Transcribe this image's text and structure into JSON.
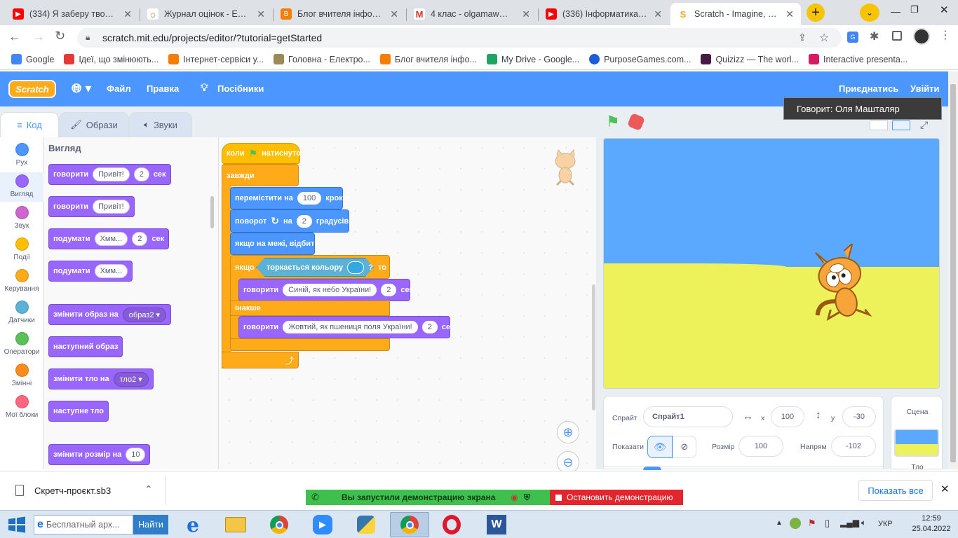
{
  "browser": {
    "tabs": [
      {
        "title": "(334) Я заберу твою се",
        "icon": "youtube-icon",
        "color": "#ff0000"
      },
      {
        "title": "Журнал оцінок - Елект",
        "icon": "sun-icon",
        "color": "#9b8a55"
      },
      {
        "title": "Блог вчителя інформа",
        "icon": "blogger-icon",
        "color": "#f57d00"
      },
      {
        "title": "4 клас - olgamaw@gm",
        "icon": "gmail-icon",
        "color": "#d93025"
      },
      {
        "title": "(336) Інформатика 4 кл",
        "icon": "youtube-icon",
        "color": "#ff0000"
      },
      {
        "title": "Scratch - Imagine, Prog",
        "icon": "scratch-icon",
        "color": "#f6a623",
        "active": true
      }
    ],
    "url": "scratch.mit.edu/projects/editor/?tutorial=getStarted",
    "bookmarks": [
      {
        "label": "Google",
        "color": "#4285f4"
      },
      {
        "label": "Ідеї, що змінюють...",
        "color": "#e53935"
      },
      {
        "label": "Інтернет-сервіси у...",
        "color": "#f57d00"
      },
      {
        "label": "Головна - Електро...",
        "color": "#9b8a55"
      },
      {
        "label": "Блог вчителя інфо...",
        "color": "#f57d00"
      },
      {
        "label": "My Drive - Google...",
        "color": "#1fa463"
      },
      {
        "label": "PurposeGames.com...",
        "color": "#1e5bd6"
      },
      {
        "label": "Quizizz — The worl...",
        "color": "#461a42"
      },
      {
        "label": "Interactive presenta...",
        "color": "#d81b60"
      }
    ]
  },
  "scratch": {
    "menu": {
      "file": "Файл",
      "edit": "Правка",
      "tutorials": "Посібники",
      "join": "Приєднатись",
      "signin": "Увійти"
    },
    "tooltip": "Говорит: Оля Машталяр",
    "tabs": {
      "code": "Код",
      "costumes": "Образи",
      "sounds": "Звуки"
    },
    "categories": [
      {
        "label": "Рух",
        "color": "#4c97ff"
      },
      {
        "label": "Вигляд",
        "color": "#9966ff"
      },
      {
        "label": "Звук",
        "color": "#cf63cf"
      },
      {
        "label": "Події",
        "color": "#ffbf00"
      },
      {
        "label": "Керування",
        "color": "#ffab19"
      },
      {
        "label": "Датчики",
        "color": "#5cb1d6"
      },
      {
        "label": "Оператори",
        "color": "#59c059"
      },
      {
        "label": "Змінні",
        "color": "#ff8c1a"
      },
      {
        "label": "Мої блоки",
        "color": "#ff6680"
      }
    ],
    "palette": {
      "heading": "Вигляд",
      "b1": {
        "say": "говорити",
        "msg": "Привіт!",
        "secs": "2",
        "unit": "сек"
      },
      "b2": {
        "say": "говорити",
        "msg": "Привіт!"
      },
      "b3": {
        "think": "подумати",
        "msg": "Хмм...",
        "secs": "2",
        "unit": "сек"
      },
      "b4": {
        "think": "подумати",
        "msg": "Хмм..."
      },
      "b5": {
        "label": "змінити образ на",
        "value": "образ2"
      },
      "b6": {
        "label": "наступний образ"
      },
      "b7": {
        "label": "змінити тло на",
        "value": "тло2"
      },
      "b8": {
        "label": "наступне тло"
      },
      "b9": {
        "label": "змінити розмір на",
        "value": "10"
      }
    },
    "script": {
      "hat": {
        "when": "коли",
        "clicked": "натиснуто"
      },
      "forever": "завжди",
      "move": {
        "label": "перемістити на",
        "steps": "100",
        "unit": "кроків"
      },
      "turn": {
        "label": "поворот",
        "on": "на",
        "deg": "2",
        "unit": "градусів"
      },
      "bounce": "якщо на межі, відбити",
      "if": {
        "if": "якщо",
        "touching": "торкається кольору",
        "q": "?",
        "then": "то",
        "else": "інакше"
      },
      "say1": {
        "say": "говорити",
        "msg": "Синій, як небо України!",
        "secs": "2",
        "unit": "сек"
      },
      "say2": {
        "say": "говорити",
        "msg": "Жовтий, як пшениця поля України!",
        "secs": "2",
        "unit": "сек"
      }
    },
    "sprite": {
      "label": "Спрайт",
      "name": "Спрайт1",
      "x_label": "x",
      "x": "100",
      "y_label": "y",
      "y": "-30",
      "show_label": "Показати",
      "size_label": "Розмір",
      "size": "100",
      "dir_label": "Напрям",
      "dir": "-102"
    },
    "scene": {
      "label": "Сцена",
      "backdrop": "Тло"
    }
  },
  "download": {
    "file": "Скретч-проєкт.sb3",
    "show_all": "Показать все"
  },
  "screenshare": {
    "status": "Вы запустили демонстрацию экрана",
    "stop": "Остановить демонстрацию"
  },
  "taskbar": {
    "search": "Бесплатный арх...",
    "search_btn": "Найти",
    "lang": "УКР",
    "time": "12:59",
    "date": "25.04.2022"
  }
}
